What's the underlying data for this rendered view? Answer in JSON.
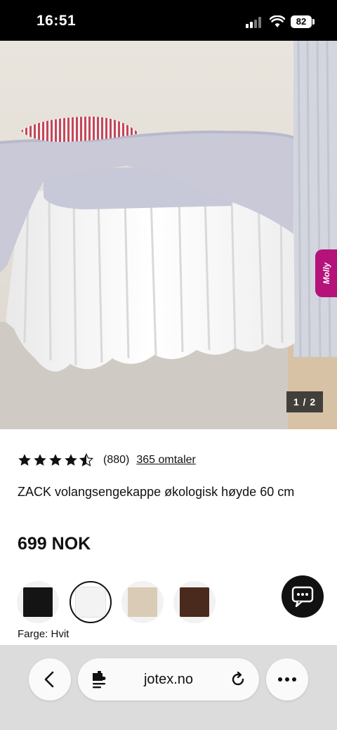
{
  "status_bar": {
    "time": "16:51",
    "battery": "82"
  },
  "product": {
    "image_counter": "1 / 2",
    "chat_widget_label": "Molly",
    "rating": 4.5,
    "rating_count": "(880)",
    "reviews_link": "365 omtaler",
    "title": "ZACK volangsengekappe økologisk høyde 60 cm",
    "price": "699 NOK",
    "swatches": [
      {
        "name": "black",
        "color": "#141414"
      },
      {
        "name": "white",
        "color": "#f3f3f3"
      },
      {
        "name": "beige",
        "color": "#d9cbb6"
      },
      {
        "name": "brown",
        "color": "#4a2a1c"
      }
    ],
    "color_label": "Farge: Hvit"
  },
  "browser": {
    "url": "jotex.no"
  },
  "icons": {
    "star": "star-icon",
    "chat": "chat-icon",
    "back": "chevron-left-icon",
    "extensions": "puzzle-icon",
    "reload": "reload-icon",
    "more": "ellipsis-icon"
  }
}
